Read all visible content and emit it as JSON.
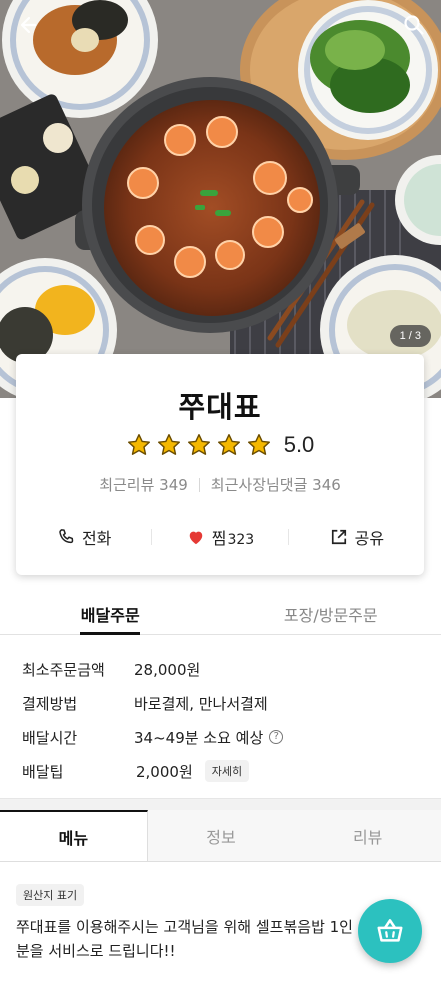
{
  "hero": {
    "page_indicator": "1 / 3",
    "image": "jjukkumi-stir-fry-photo"
  },
  "store": {
    "name": "쭈대표",
    "rating": "5.0",
    "stars": 5,
    "recent_reviews": "최근리뷰 349",
    "owner_replies": "최근사장님댓글 346"
  },
  "actions": {
    "call": "전화",
    "like": "찜",
    "like_count": "323",
    "share": "공유"
  },
  "order_tabs": [
    "배달주문",
    "포장/방문주문"
  ],
  "info": {
    "min_order_label": "최소주문금액",
    "min_order_value": "28,000원",
    "payment_label": "결제방법",
    "payment_value": "바로결제, 만나서결제",
    "delivery_time_label": "배달시간",
    "delivery_time_value": "34~49분 소요 예상",
    "tip_label": "배달팁",
    "tip_value": "2,000원",
    "tip_detail": "자세히"
  },
  "menu_tabs": [
    "메뉴",
    "정보",
    "리뷰"
  ],
  "origin_badge": "원산지 표기",
  "notice": "쭈대표를 이용해주시는 고객님을 위해 셀프볶음밥 1인분을 서비스로 드립니다!!",
  "colors": {
    "accent": "#2cc1bf",
    "star": "#f5b800",
    "heart": "#e53935"
  },
  "icons": [
    "back-arrow-icon",
    "search-icon",
    "star-icon",
    "phone-icon",
    "heart-icon",
    "share-icon",
    "help-icon",
    "cart-basket-icon"
  ]
}
